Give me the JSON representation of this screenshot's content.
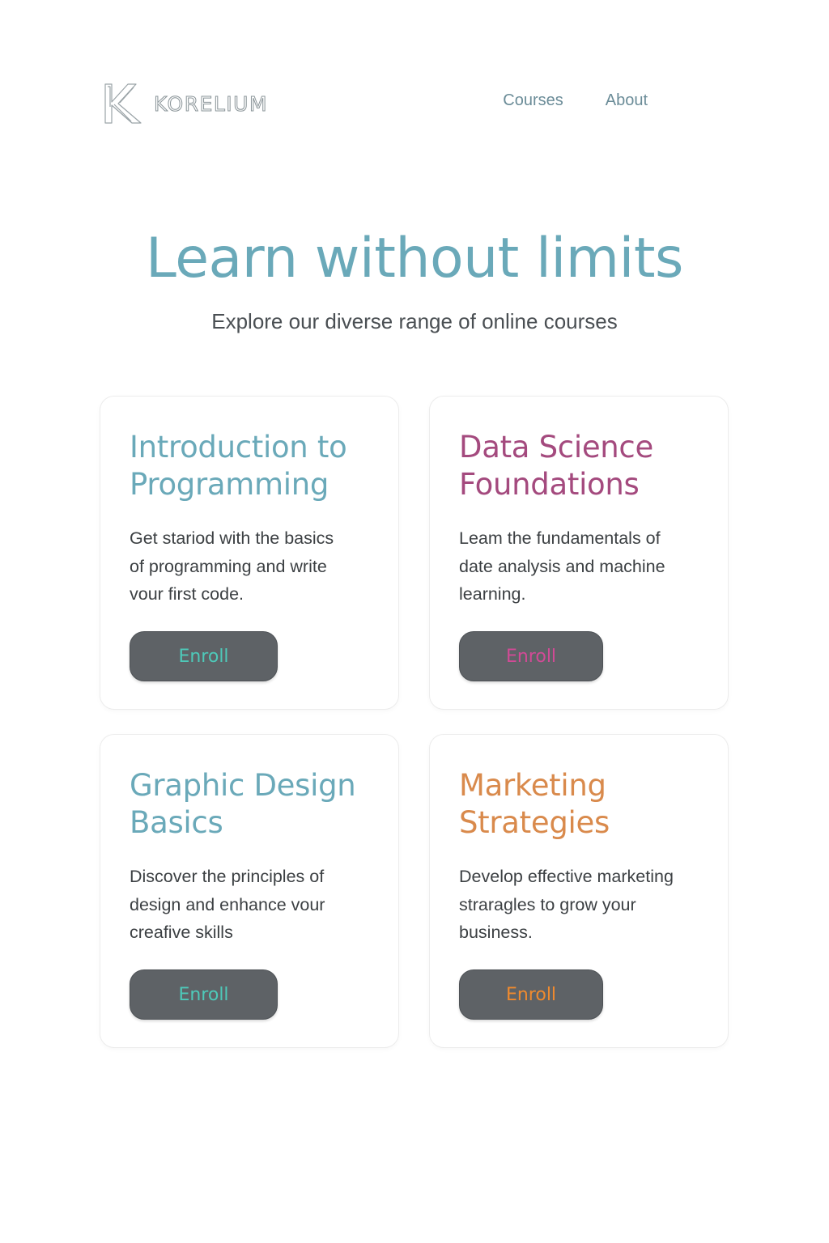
{
  "brand": {
    "name": "KORELIUM",
    "mark": "K"
  },
  "nav": {
    "items": [
      "Courses",
      "About"
    ]
  },
  "hero": {
    "title": "Learn without limits",
    "subtitle": "Explore our diverse range of online courses"
  },
  "courses": [
    {
      "title_line1": "Introduction to",
      "title_line2": "Programming",
      "desc_line1": "Get stariod  with the basics",
      "desc_line2": "of programming and write",
      "desc_line3": "vour first code.",
      "button": "Enroll",
      "title_color": "#6aa9b9",
      "button_text_color": "#4ec9b9"
    },
    {
      "title_line1": "Data Science",
      "title_line2": "Foundations",
      "desc_line1": "Leam the fundamentals of",
      "desc_line2": "date analysis and machine",
      "desc_line3": "learning.",
      "button": "Enroll",
      "title_color": "#a44a7e",
      "button_text_color": "#d24a96"
    },
    {
      "title_line1": "Graphic Design",
      "title_line2": "Basics",
      "desc_line1": "Discover the principles of",
      "desc_line2": "design and enhance vour",
      "desc_line3": "creafive skills",
      "button": "Enroll",
      "title_color": "#6aa9b9",
      "button_text_color": "#4ec9b9"
    },
    {
      "title_line1": "Marketing",
      "title_line2": "Strategies",
      "desc_line1": "Develop effective marketing",
      "desc_line2": "straragles to grow your",
      "desc_line3": "business.",
      "button": "Enroll",
      "title_color": "#d98a4c",
      "button_text_color": "#f08a2e"
    }
  ],
  "colors": {
    "background": "#ffffff",
    "button_bg": "#5e6266",
    "body_text": "#3c4043",
    "nav_text": "#6b8c98"
  }
}
